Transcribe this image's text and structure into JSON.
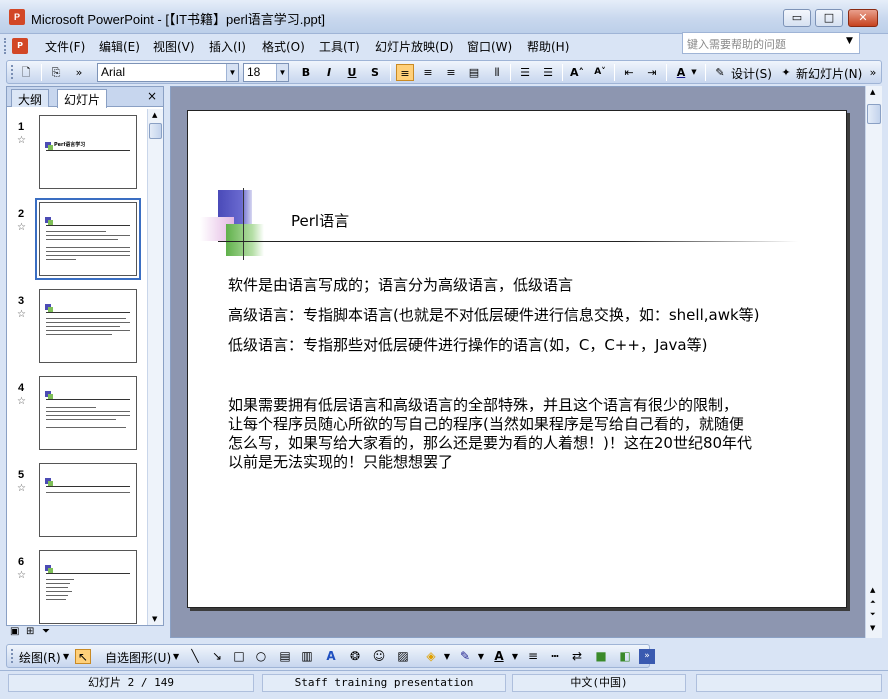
{
  "window": {
    "title": "Microsoft PowerPoint - [【IT书籍】perl语言学习.ppt]",
    "min_label": "▭",
    "max_label": "□",
    "close_label": "✕"
  },
  "menu": {
    "items": [
      "文件(F)",
      "编辑(E)",
      "视图(V)",
      "插入(I)",
      "格式(O)",
      "工具(T)",
      "幻灯片放映(D)",
      "窗口(W)",
      "帮助(H)"
    ],
    "help_placeholder": "键入需要帮助的问题"
  },
  "format_toolbar": {
    "font": "Arial",
    "size": "18",
    "bold": "B",
    "italic": "I",
    "underline": "U",
    "shadow": "S",
    "design_label": "设计(S)",
    "new_slide_label": "新幻灯片(N)"
  },
  "panel": {
    "tab_outline": "大纲",
    "tab_slides": "幻灯片",
    "close": "×",
    "thumbnails": [
      {
        "num": "1",
        "title": "Perl语言学习"
      },
      {
        "num": "2",
        "title": ""
      },
      {
        "num": "3",
        "title": ""
      },
      {
        "num": "4",
        "title": ""
      },
      {
        "num": "5",
        "title": ""
      },
      {
        "num": "6",
        "title": ""
      }
    ],
    "selected_index": 2
  },
  "slide": {
    "title": "Perl语言",
    "lines": [
      "软件是由语言写成的；语言分为高级语言，低级语言",
      "高级语言：专指脚本语言(也就是不对低层硬件进行信息交换，如：shell,awk等)",
      "低级语言：专指那些对低层硬件进行操作的语言(如，C，C++，Java等)"
    ],
    "paragraph": [
      "如果需要拥有低层语言和高级语言的全部特殊，并且这个语言有很少的限制，",
      "让每个程序员随心所欲的写自己的程序(当然如果程序是写给自己看的，就随便",
      "怎么写，如果写给大家看的，那么还是要为看的人着想！)！这在20世纪80年代",
      "以前是无法实现的！只能想想罢了"
    ]
  },
  "drawing_toolbar": {
    "draw_label": "绘图(R)",
    "autoshapes_label": "自选图形(U)"
  },
  "status": {
    "slide_info": "幻灯片 2 / 149",
    "template": "Staff training presentation",
    "language": "中文(中国)"
  }
}
